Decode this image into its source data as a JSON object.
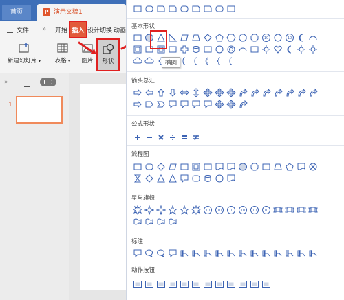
{
  "tabs": {
    "home_label": "首页",
    "document_icon": "P",
    "document_title": "演示文稿1"
  },
  "menu": {
    "file_label": "文件",
    "separator": "»",
    "start_label": "开始",
    "insert_label": "插入",
    "design_label": "设计",
    "switch_label": "切换",
    "animation_label": "动画"
  },
  "toolbar": {
    "new_slide_label": "新建幻灯片",
    "table_label": "表格",
    "picture_label": "图片",
    "shape_label": "形状"
  },
  "slides": {
    "slide_number": "1",
    "collapse_label": "»"
  },
  "shape_panel": {
    "sections": [
      {
        "title": "基本形状"
      },
      {
        "title": "箭头总汇"
      },
      {
        "title": "公式形状"
      },
      {
        "title": "流程图"
      },
      {
        "title": "星与旗帜"
      },
      {
        "title": "标注"
      },
      {
        "title": "动作按钮"
      }
    ],
    "tooltip": "椭圆",
    "accent": "#3d64b4"
  },
  "colors": {
    "tabbar": "#3e6fb8",
    "highlight": "#e02020",
    "title_orange": "#d84c23"
  }
}
